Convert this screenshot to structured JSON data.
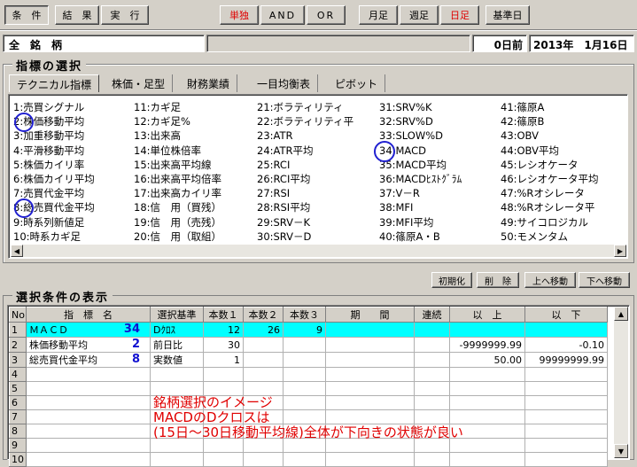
{
  "toolbar": {
    "condition": "条　件",
    "result": "結　果",
    "run": "実　行",
    "single": "単独",
    "and": "AND",
    "or": "OR",
    "monthly": "月足",
    "weekly": "週足",
    "daily": "日足",
    "base_date": "基準日"
  },
  "infobar": {
    "scope": "全　銘　柄",
    "days_before": "0日前",
    "date": "2013年　1月16日"
  },
  "indicator_section": {
    "title": "指標の選択",
    "tabs": [
      "テクニカル指標",
      "株価・足型",
      "財務業績",
      "一目均衡表",
      "ピボット"
    ],
    "columns": [
      [
        "1:売買シグナル",
        "2:株価移動平均",
        "3:加重移動平均",
        "4:平滑移動平均",
        "5:株価カイリ率",
        "6:株価カイリ平均",
        "7:売買代金平均",
        "8:総売買代金平均",
        "9:時系列新値足",
        "10:時系カギ足"
      ],
      [
        "11:カギ足",
        "12:カギ足%",
        "13:出来高",
        "14:単位株倍率",
        "15:出来高平均線",
        "16:出来高平均倍率",
        "17:出来高カイリ率",
        "18:信　用（買残）",
        "19:信　用（売残）",
        "20:信　用（取組）"
      ],
      [
        "21:ボラティリティ",
        "22:ボラティリティ平",
        "23:ATR",
        "24:ATR平均",
        "25:RCI",
        "26:RCI平均",
        "27:RSI",
        "28:RSI平均",
        "29:SRV－K",
        "30:SRV－D"
      ],
      [
        "31:SRV%K",
        "32:SRV%D",
        "33:SLOW%D",
        "34:MACD",
        "35:MACD平均",
        "36:MACDﾋｽﾄｸﾞﾗﾑ",
        "37:V－R",
        "38:MFI",
        "39:MFI平均",
        "40:篠原A・B"
      ],
      [
        "41:篠原A",
        "42:篠原B",
        "43:OBV",
        "44:OBV平均",
        "45:レシオケータ",
        "46:レシオケータ平均",
        "47:%Rオシレータ",
        "48:%Rオシレータ平",
        "49:サイコロジカル",
        "50:モメンタム"
      ]
    ]
  },
  "list_buttons": {
    "init": "初期化",
    "delete": "削　除",
    "move_up": "上へ移動",
    "move_down": "下へ移動"
  },
  "conditions": {
    "title": "選択条件の表示",
    "headers": [
      "No",
      "指　標　名",
      "選択基準",
      "本数１",
      "本数２",
      "本数３",
      "期　　間",
      "連続",
      "以　上",
      "以　下"
    ],
    "rows": [
      {
        "no": "1",
        "name": "ＭＡＣＤ",
        "mark": "34",
        "basis": "Dｸﾛｽ",
        "n1": "12",
        "n2": "26",
        "n3": "9",
        "period": "",
        "cont": "",
        "min": "",
        "max": ""
      },
      {
        "no": "2",
        "name": "株価移動平均",
        "mark": "2",
        "basis": "前日比",
        "n1": "30",
        "n2": "",
        "n3": "",
        "period": "",
        "cont": "",
        "min": "-9999999.99",
        "max": "-0.10"
      },
      {
        "no": "3",
        "name": "総売買代金平均",
        "mark": "8",
        "basis": "実数値",
        "n1": "1",
        "n2": "",
        "n3": "",
        "period": "",
        "cont": "",
        "min": "50.00",
        "max": "99999999.99"
      },
      {
        "no": "4"
      },
      {
        "no": "5"
      },
      {
        "no": "6"
      },
      {
        "no": "7"
      },
      {
        "no": "8"
      },
      {
        "no": "9"
      },
      {
        "no": "10"
      }
    ],
    "annotation": [
      "銘柄選択のイメージ",
      "MACDのDクロスは",
      "(15日～30日移動平均線)全体が下向きの状態が良い"
    ]
  },
  "colors": {
    "selected_row": "#00ffff",
    "accent_red": "#e00000",
    "mark_blue": "#1010d0"
  },
  "icons": [
    "scroll-left-icon",
    "scroll-right-icon",
    "scroll-up-icon",
    "scroll-down-icon"
  ]
}
